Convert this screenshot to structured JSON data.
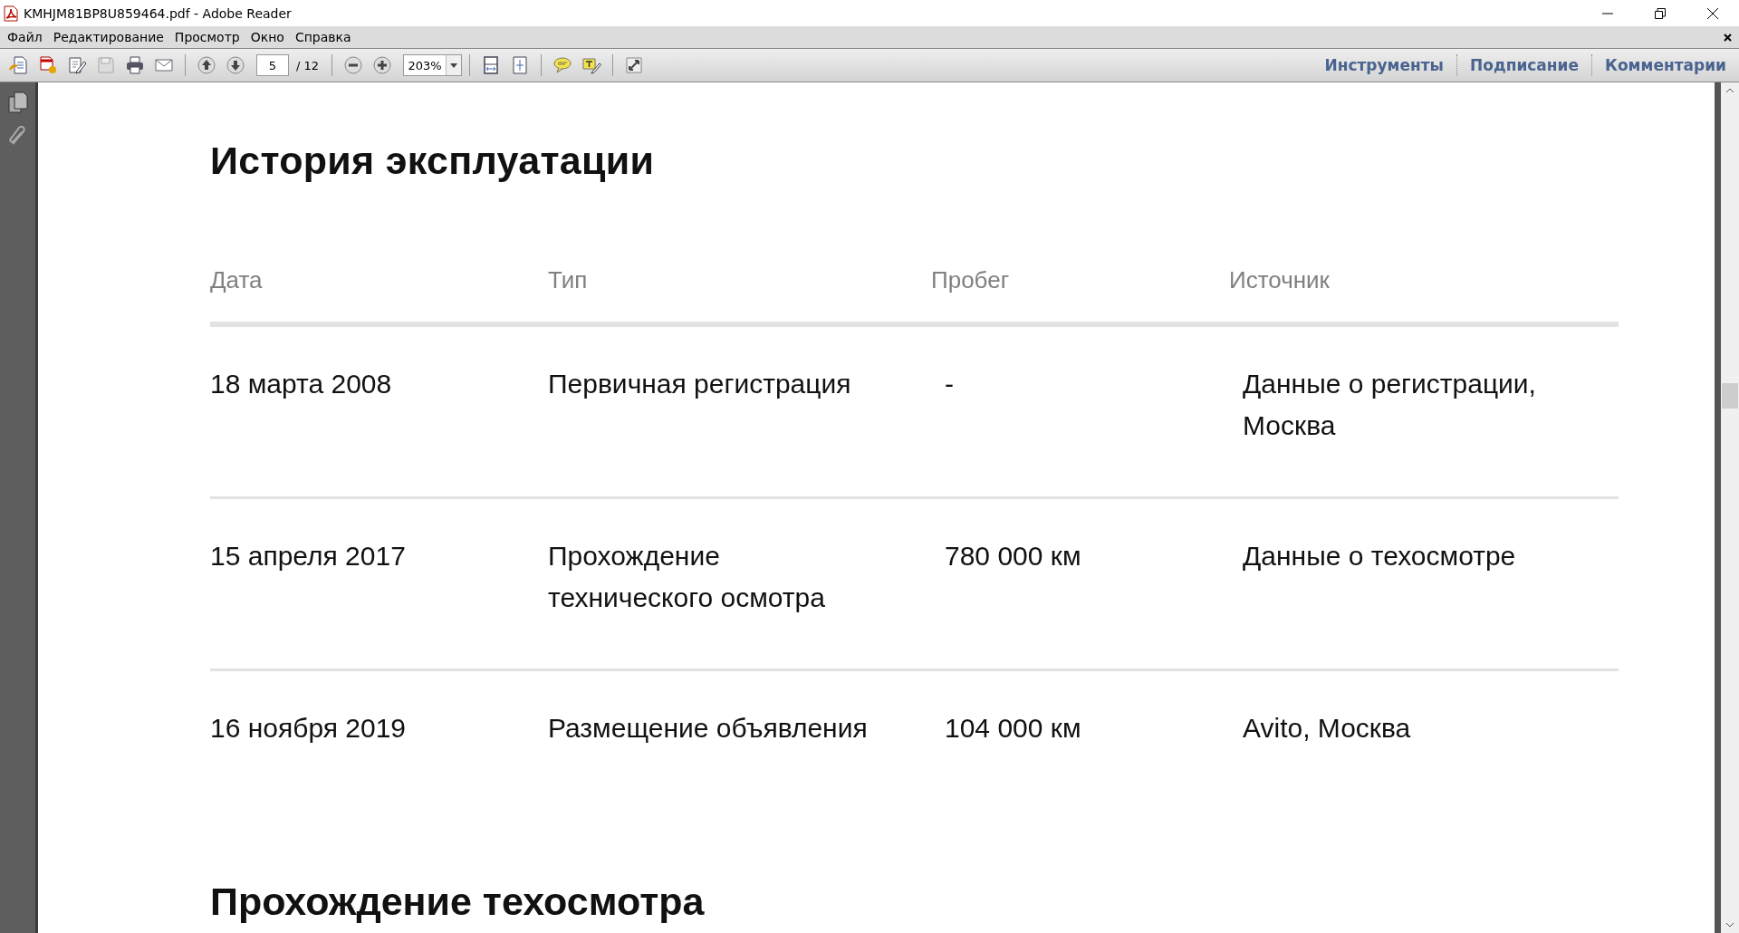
{
  "window": {
    "title": "KMHJM81BP8U859464.pdf - Adobe Reader"
  },
  "menu": [
    "Файл",
    "Редактирование",
    "Просмотр",
    "Окно",
    "Справка"
  ],
  "toolbar": {
    "page": "5",
    "page_total": "/ 12",
    "zoom": "203%",
    "panels": [
      "Инструменты",
      "Подписание",
      "Комментарии"
    ]
  },
  "document": {
    "heading": "История эксплуатации",
    "columns": [
      "Дата",
      "Тип",
      "Пробег",
      "Источник"
    ],
    "rows": [
      {
        "cells": [
          "18 марта 2008",
          "Первичная регистрация",
          "-",
          "Данные о регистрации, Москва"
        ]
      },
      {
        "cells": [
          "15 апреля 2017",
          "Прохождение технического осмотра",
          "780 000 км",
          "Данные о техосмотре"
        ]
      },
      {
        "cells": [
          "16 ноября 2019",
          "Размещение объявления",
          "104 000 км",
          "Avito, Москва"
        ]
      }
    ],
    "next_heading": "Прохождение техосмотра"
  }
}
